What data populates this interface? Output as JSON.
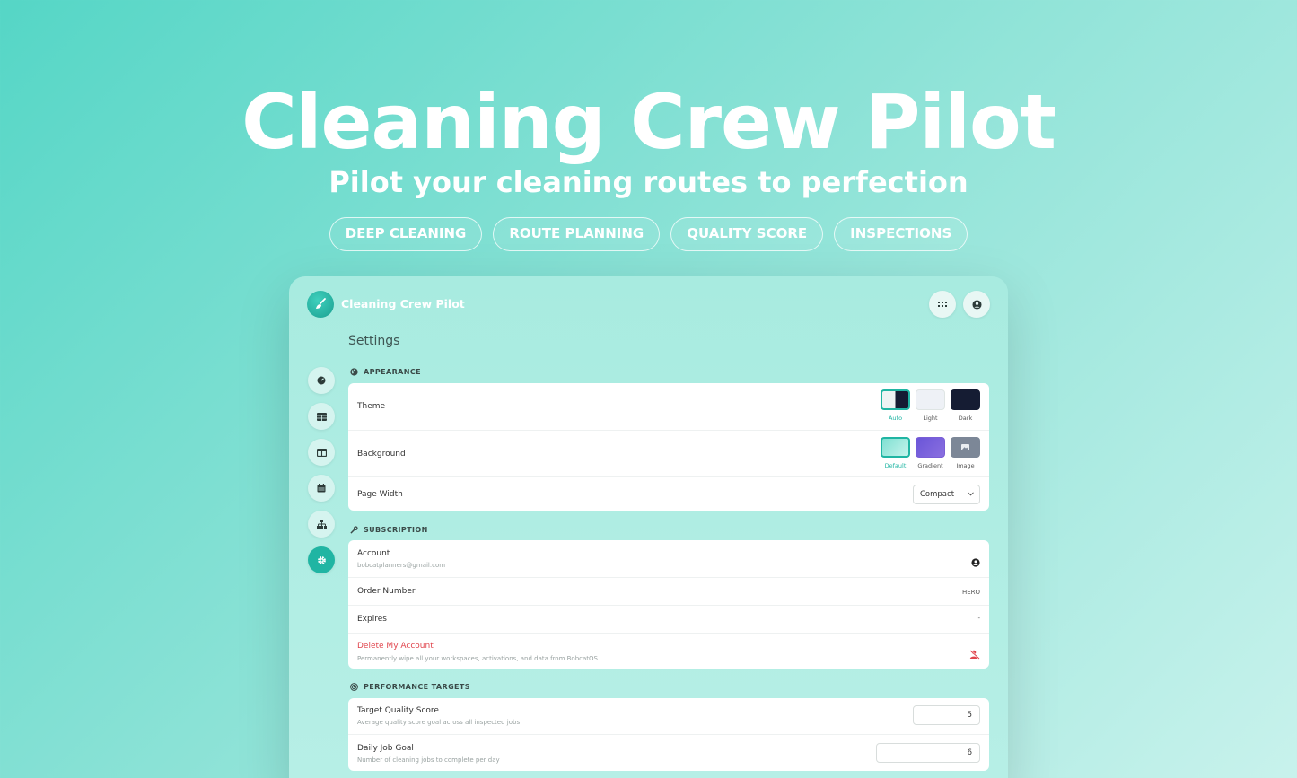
{
  "hero": {
    "title": "Cleaning Crew Pilot",
    "subtitle": "Pilot your cleaning routes to perfection",
    "pills": [
      "DEEP CLEANING",
      "ROUTE PLANNING",
      "QUALITY SCORE",
      "INSPECTIONS"
    ]
  },
  "app": {
    "name": "Cleaning Crew Pilot",
    "logo_icon": "broom-icon",
    "top_buttons": [
      "apps-grid-icon",
      "account-circle-icon"
    ]
  },
  "sidebar": {
    "items": [
      {
        "icon": "dashboard-gauge-icon",
        "active": false
      },
      {
        "icon": "table-icon",
        "active": false
      },
      {
        "icon": "board-columns-icon",
        "active": false
      },
      {
        "icon": "calendar-icon",
        "active": false
      },
      {
        "icon": "sitemap-icon",
        "active": false
      },
      {
        "icon": "gear-icon",
        "active": true
      }
    ]
  },
  "page": {
    "title": "Settings"
  },
  "appearance": {
    "heading": "APPEARANCE",
    "theme_label": "Theme",
    "theme_options": [
      {
        "label": "Auto",
        "selected": true
      },
      {
        "label": "Light",
        "selected": false
      },
      {
        "label": "Dark",
        "selected": false
      }
    ],
    "background_label": "Background",
    "background_options": [
      {
        "label": "Default",
        "selected": true
      },
      {
        "label": "Gradient",
        "selected": false
      },
      {
        "label": "Image",
        "selected": false
      }
    ],
    "page_width_label": "Page Width",
    "page_width_value": "Compact"
  },
  "subscription": {
    "heading": "SUBSCRIPTION",
    "account_label": "Account",
    "account_email": "bobcatplanners@gmail.com",
    "order_label": "Order Number",
    "order_value": "HERO",
    "expires_label": "Expires",
    "expires_value": "-",
    "delete_label": "Delete My Account",
    "delete_desc": "Permanently wipe all your workspaces, activations, and data from BobcatOS."
  },
  "performance": {
    "heading": "PERFORMANCE TARGETS",
    "quality_label": "Target Quality Score",
    "quality_desc": "Average quality score goal across all inspected jobs",
    "quality_value": "5",
    "daily_label": "Daily Job Goal",
    "daily_desc": "Number of cleaning jobs to complete per day",
    "daily_value": "6"
  },
  "colors": {
    "accent": "#20b5a3",
    "danger": "#e0444c",
    "gradient_purple": "#7a5fd6",
    "dark_swatch": "#151c33"
  }
}
